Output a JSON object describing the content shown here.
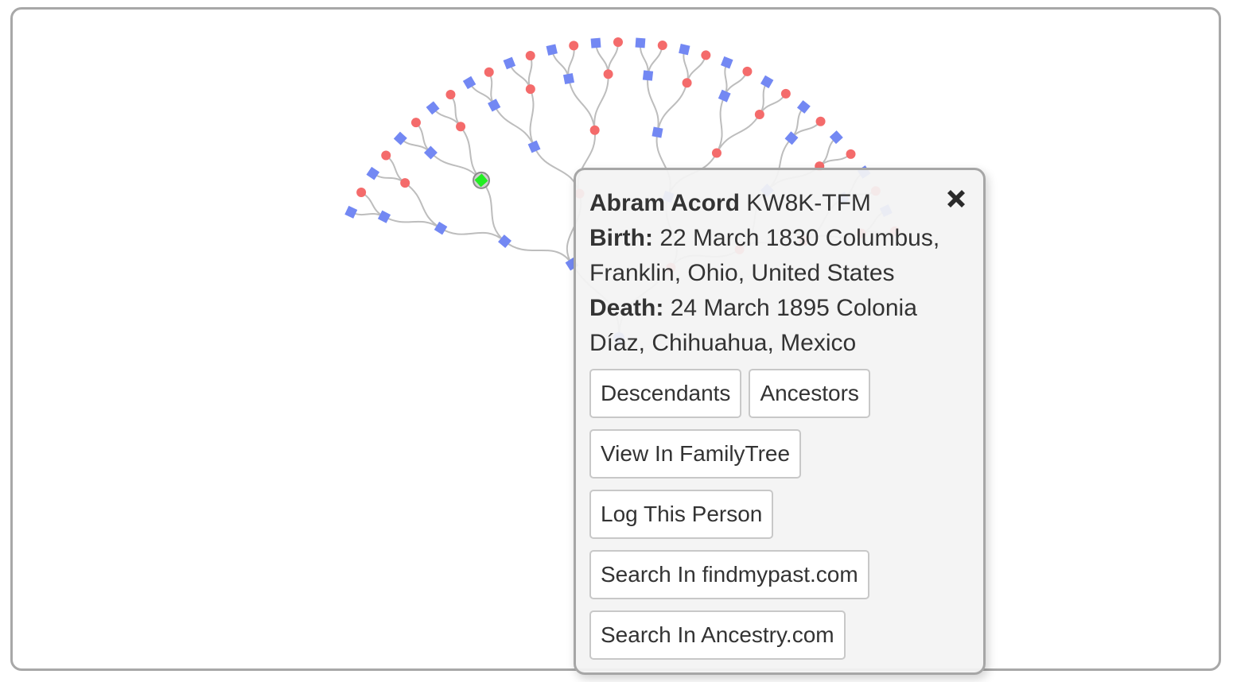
{
  "person": {
    "name": "Abram Acord",
    "id": "KW8K-TFM",
    "birth_label": "Birth:",
    "birth": "22 March 1830 Columbus, Franklin, Ohio, United States",
    "death_label": "Death:",
    "death": "24 March 1895 Colonia Díaz, Chihuahua, Mexico"
  },
  "actions": {
    "descendants": "Descendants",
    "ancestors": "Ancestors",
    "view_familytree": "View In FamilyTree",
    "log_person": "Log This Person",
    "search_findmypast": "Search In findmypast.com",
    "search_ancestry": "Search In Ancestry.com"
  },
  "icons": {
    "close": "close-icon"
  },
  "colors": {
    "male": "#7388f3",
    "female": "#f46b6b",
    "selected": "#22ee22",
    "link": "#bdbdbd",
    "frame_border": "#a8a8a8",
    "popover_bg": "#f3f3f3"
  }
}
